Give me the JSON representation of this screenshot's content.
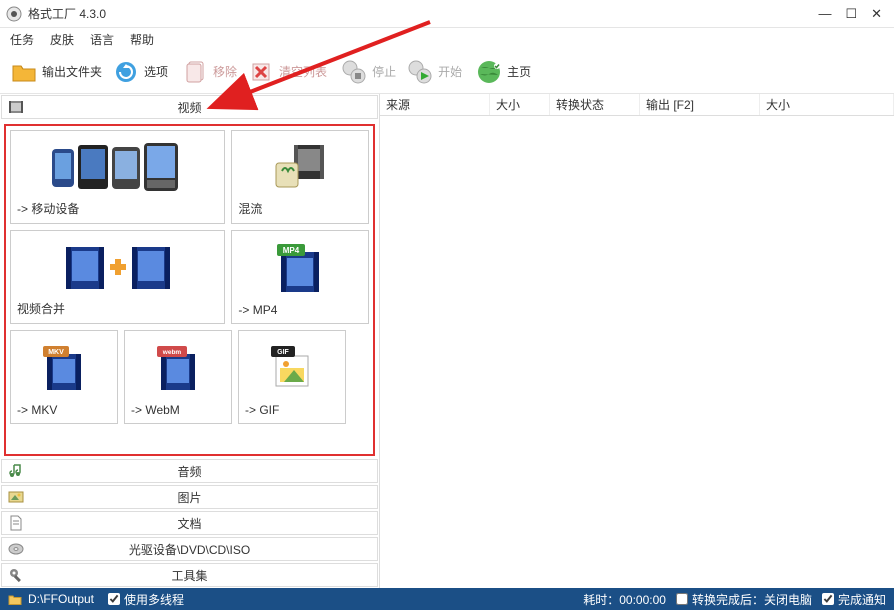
{
  "title": "格式工厂 4.3.0",
  "menus": [
    "任务",
    "皮肤",
    "语言",
    "帮助"
  ],
  "toolbar": {
    "output_folder": "输出文件夹",
    "options": "选项",
    "remove": "移除",
    "clear_list": "清空列表",
    "stop": "停止",
    "start": "开始",
    "home": "主页"
  },
  "categories": {
    "video": "视频",
    "audio": "音频",
    "image": "图片",
    "document": "文档",
    "drive": "光驱设备\\DVD\\CD\\ISO",
    "toolset": "工具集"
  },
  "tiles": {
    "mobile": "-> 移动设备",
    "mux": "混流",
    "merge": "视频合并",
    "mp4": "-> MP4",
    "mkv": "-> MKV",
    "webm": "-> WebM",
    "gif": "-> GIF"
  },
  "table_headers": {
    "source": "来源",
    "size": "大小",
    "state": "转换状态",
    "output": "输出 [F2]",
    "size2": "大小"
  },
  "statusbar": {
    "output_path": "D:\\FFOutput",
    "multithread": "使用多线程",
    "elapsed_label": "耗时：",
    "elapsed_time": "00:00:00",
    "shutdown_label": "转换完成后：关闭电脑",
    "notify_label": "完成通知"
  }
}
